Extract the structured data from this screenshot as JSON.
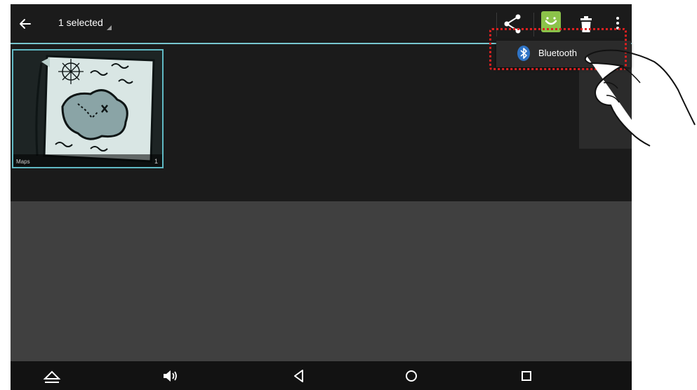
{
  "action_bar": {
    "selection_label": "1 selected"
  },
  "gallery": {
    "items": [
      {
        "album_label": "Maps",
        "count": "1"
      }
    ]
  },
  "popup_menu": {
    "items": [
      {
        "label": "Bluetooth",
        "icon": "bluetooth-icon"
      }
    ]
  },
  "colors": {
    "accent": "#78c7d0",
    "highlight": "#e02020",
    "android_green": "#8bc34a"
  }
}
